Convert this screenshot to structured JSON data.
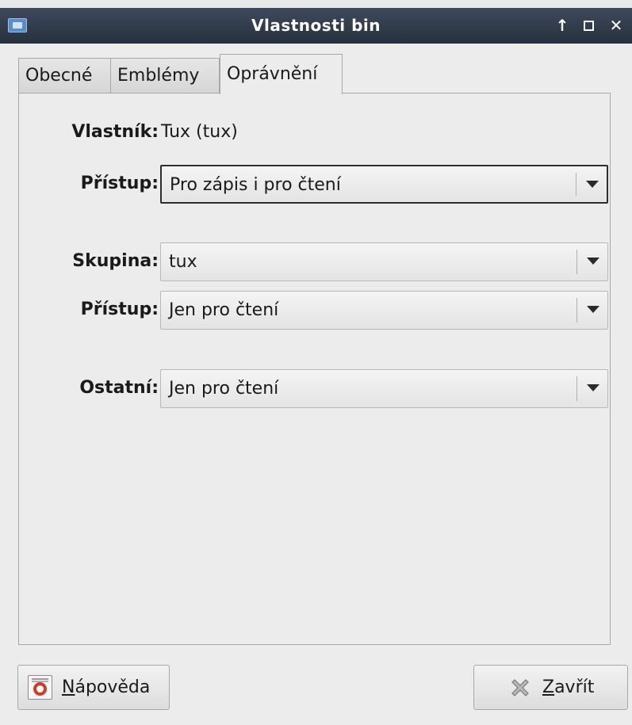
{
  "window": {
    "title": "Vlastnosti bin",
    "shade_symbol": "↑",
    "maximize_symbol": "□",
    "close_symbol": "✕"
  },
  "tabs": [
    {
      "label": "Obecné",
      "active": false
    },
    {
      "label": "Emblémy",
      "active": false
    },
    {
      "label": "Oprávnění",
      "active": true
    }
  ],
  "permissions": {
    "owner_label": "Vlastník:",
    "owner_value": "Tux (tux)",
    "owner_access_label": "Přístup:",
    "owner_access_value": "Pro zápis i pro čtení",
    "group_label": "Skupina:",
    "group_value": "tux",
    "group_access_label": "Přístup:",
    "group_access_value": "Jen pro čtení",
    "others_label": "Ostatní:",
    "others_value": "Jen pro čtení"
  },
  "buttons": {
    "help_mnemonic": "N",
    "help_rest": "ápověda",
    "close_mnemonic": "Z",
    "close_rest": "avřít"
  },
  "icons": {
    "window_icon": "folder-icon",
    "help_icon": "lifebuoy-icon",
    "close_icon": "close-x-icon"
  }
}
